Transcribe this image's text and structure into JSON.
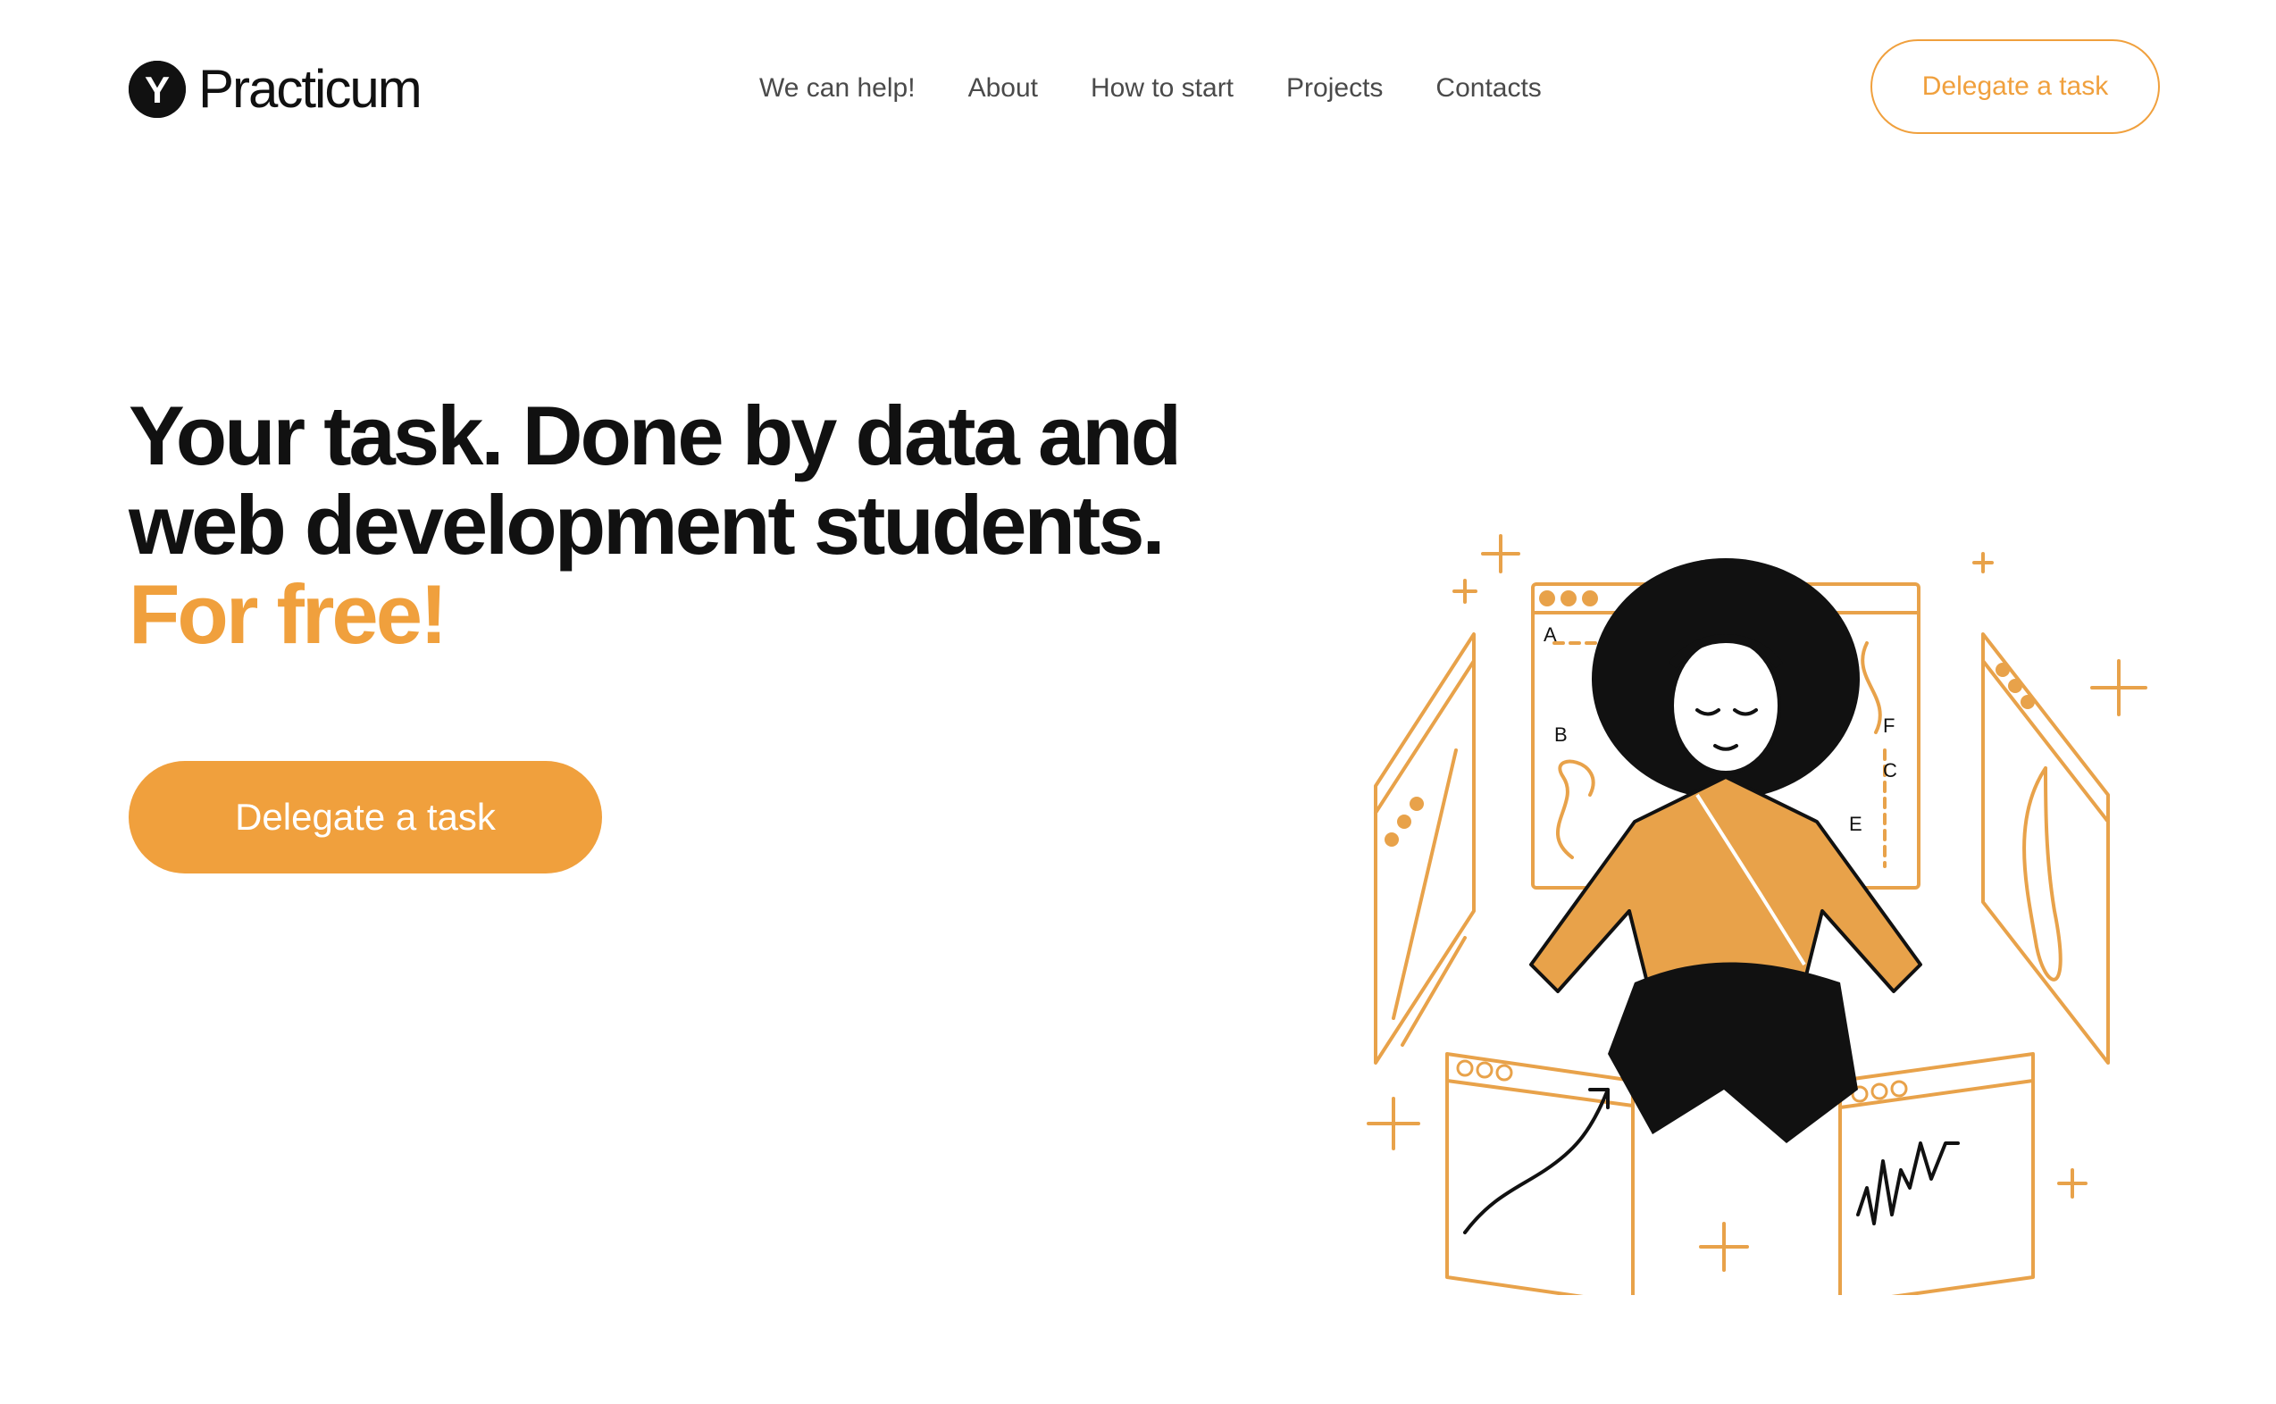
{
  "brand": {
    "name": "Practicum",
    "mark": "Y",
    "accent_color": "#F0A03D",
    "text_color": "#111111"
  },
  "nav": {
    "items": [
      "We can help!",
      "About",
      "How to start",
      "Projects",
      "Contacts"
    ]
  },
  "header": {
    "cta_label": "Delegate a task"
  },
  "hero": {
    "title_line1": "Your task. Done by data and",
    "title_line2": "web development students.",
    "title_accent": "For free!",
    "cta_label": "Delegate a task"
  },
  "illustration": {
    "chart_labels": [
      "A",
      "B",
      "F",
      "C",
      "E"
    ],
    "icon": "meditating-student-illustration"
  }
}
